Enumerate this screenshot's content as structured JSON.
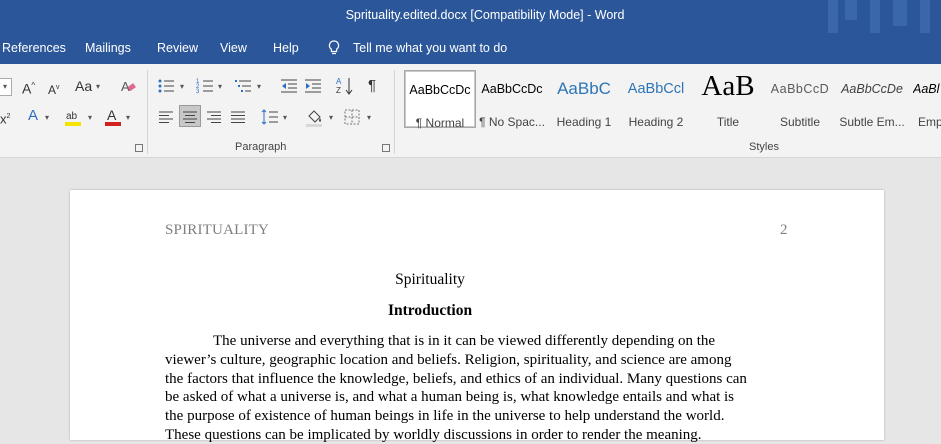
{
  "window": {
    "title": "Sprituality.edited.docx [Compatibility Mode]  -  Word"
  },
  "menu": {
    "items": [
      "References",
      "Mailings",
      "Review",
      "View",
      "Help"
    ],
    "tell_me": "Tell me what you want to do"
  },
  "ribbon": {
    "font_group": {
      "label": ""
    },
    "paragraph_group": {
      "label": "Paragraph"
    },
    "styles_group": {
      "label": "Styles"
    },
    "font_case_label": "Aa",
    "styles": [
      {
        "sample": "AaBbCcDc",
        "name": "¶ Normal"
      },
      {
        "sample": "AaBbCcDc",
        "name": "¶ No Spac..."
      },
      {
        "sample": "AaBbC",
        "name": "Heading 1"
      },
      {
        "sample": "AaBbCcl",
        "name": "Heading 2"
      },
      {
        "sample": "AaB",
        "name": "Title"
      },
      {
        "sample": "AaBbCcD",
        "name": "Subtitle"
      },
      {
        "sample": "AaBbCcDe",
        "name": "Subtle Em..."
      },
      {
        "sample": "AaBl",
        "name": "Emp"
      }
    ]
  },
  "document": {
    "header_left": "SPIRITUALITY",
    "header_right": "2",
    "title": "Spirituality",
    "heading": "Introduction",
    "body_lines": [
      "The universe and everything that is in it can be viewed differently depending on the",
      "viewer’s culture, geographic location and beliefs. Religion, spirituality, and science are among",
      "the factors that influence the knowledge, beliefs, and ethics of an individual. Many questions can",
      "be asked of what a universe is, and what a human being is, what knowledge entails and what is",
      "the purpose of existence of human beings in life in the universe to help understand the world.",
      "These questions can be implicated by worldly discussions in order to render the meaning."
    ]
  },
  "colors": {
    "accent": "#2b579a",
    "ribbon_bg": "#f3f3f3",
    "canvas_bg": "#e6e6e6"
  }
}
